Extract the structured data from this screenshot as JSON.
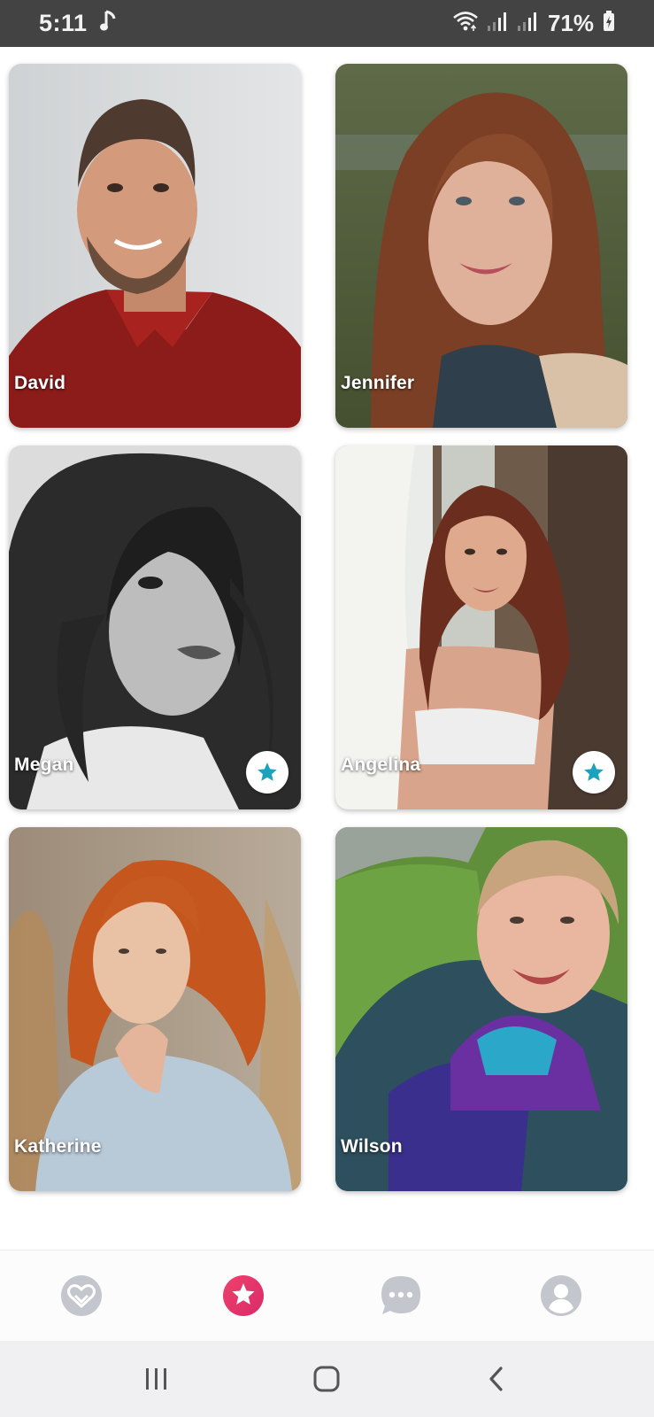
{
  "status_bar": {
    "time": "5:11",
    "battery": "71%",
    "icons": [
      "music-note-icon",
      "wifi-icon",
      "signal-icon",
      "signal-icon",
      "battery-charging-icon"
    ]
  },
  "profiles": [
    {
      "name": "David",
      "starred": false
    },
    {
      "name": "Jennifer",
      "starred": false
    },
    {
      "name": "Megan",
      "starred": true
    },
    {
      "name": "Angelina",
      "starred": true
    },
    {
      "name": "Katherine",
      "starred": false
    },
    {
      "name": "Wilson",
      "starred": false
    }
  ],
  "bottom_nav": {
    "items": [
      {
        "icon": "heart-match-icon",
        "active": false
      },
      {
        "icon": "star-icon",
        "active": true
      },
      {
        "icon": "chat-bubble-icon",
        "active": false
      },
      {
        "icon": "profile-icon",
        "active": false
      }
    ],
    "active_color": "#e8336b",
    "inactive_color": "#c3c6cc"
  },
  "system_nav": {
    "items": [
      "recent-apps-icon",
      "home-icon",
      "back-icon"
    ]
  },
  "colors": {
    "status_bar_bg": "#444343",
    "badge_star": "#1ba3bd"
  }
}
